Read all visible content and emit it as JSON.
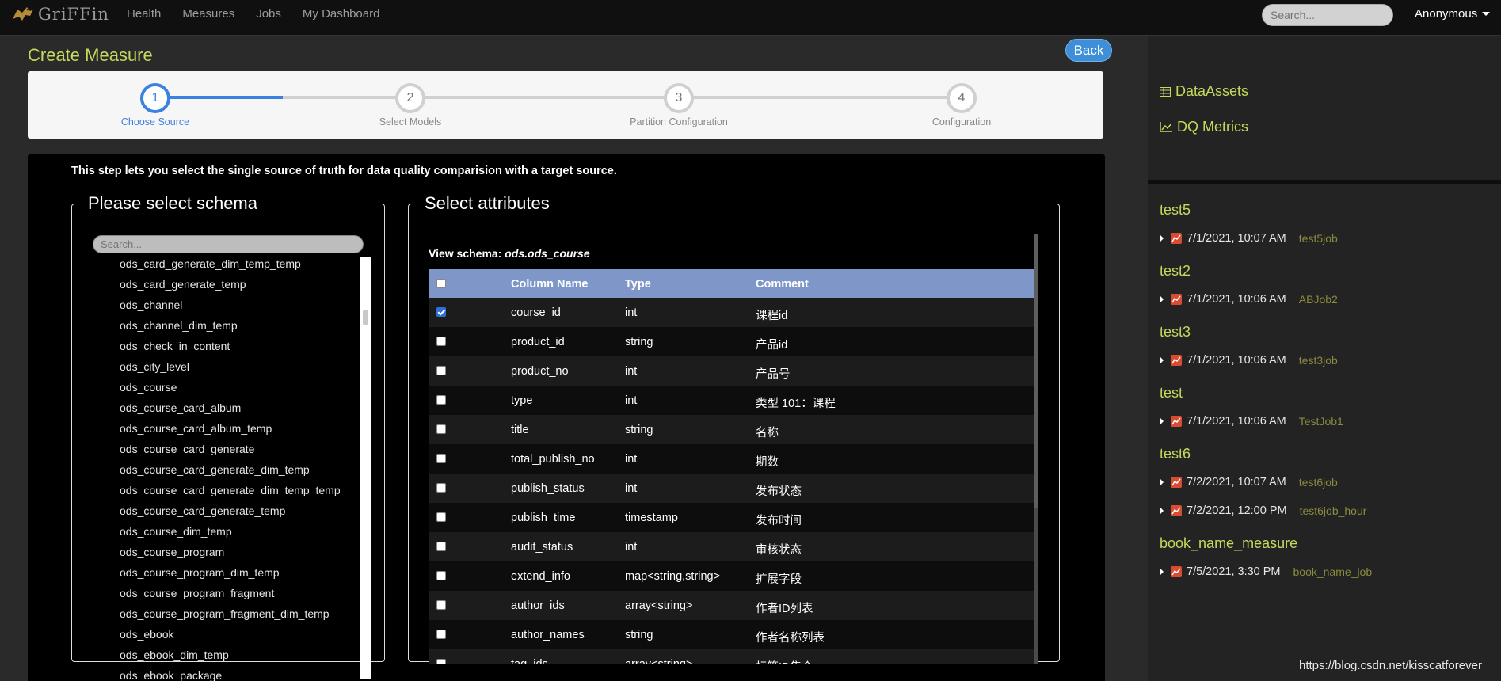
{
  "navbar": {
    "brand": "GriFFin",
    "links": [
      "Health",
      "Measures",
      "Jobs",
      "My Dashboard"
    ],
    "search_placeholder": "Search...",
    "user": "Anonymous"
  },
  "page": {
    "title": "Create Measure",
    "back_label": "Back",
    "steps": [
      {
        "number": "1",
        "label": "Choose Source",
        "active": true
      },
      {
        "number": "2",
        "label": "Select Models",
        "active": false
      },
      {
        "number": "3",
        "label": "Partition Configuration",
        "active": false
      },
      {
        "number": "4",
        "label": "Configuration",
        "active": false
      }
    ],
    "intro": "This step lets you select the single source of truth for data quality comparision with a target source."
  },
  "schema_panel": {
    "legend": "Please select schema",
    "search_placeholder": "Search...",
    "items": [
      "ods_card_generate_dim_temp_temp",
      "ods_card_generate_temp",
      "ods_channel",
      "ods_channel_dim_temp",
      "ods_check_in_content",
      "ods_city_level",
      "ods_course",
      "ods_course_card_album",
      "ods_course_card_album_temp",
      "ods_course_card_generate",
      "ods_course_card_generate_dim_temp",
      "ods_course_card_generate_dim_temp_temp",
      "ods_course_card_generate_temp",
      "ods_course_dim_temp",
      "ods_course_program",
      "ods_course_program_dim_temp",
      "ods_course_program_fragment",
      "ods_course_program_fragment_dim_temp",
      "ods_ebook",
      "ods_ebook_dim_temp",
      "ods_ebook_package"
    ]
  },
  "attr_panel": {
    "legend": "Select attributes",
    "view_schema_label": "View schema:",
    "view_schema_value": "ods.ods_course",
    "columns": [
      "Column Name",
      "Type",
      "Comment"
    ],
    "rows": [
      {
        "name": "course_id",
        "type": "int",
        "comment": "课程id",
        "checked": true
      },
      {
        "name": "product_id",
        "type": "string",
        "comment": "产品id",
        "checked": false
      },
      {
        "name": "product_no",
        "type": "int",
        "comment": "产品号",
        "checked": false
      },
      {
        "name": "type",
        "type": "int",
        "comment": "类型 101：课程",
        "checked": false
      },
      {
        "name": "title",
        "type": "string",
        "comment": "名称",
        "checked": false
      },
      {
        "name": "total_publish_no",
        "type": "int",
        "comment": "期数",
        "checked": false
      },
      {
        "name": "publish_status",
        "type": "int",
        "comment": "发布状态",
        "checked": false
      },
      {
        "name": "publish_time",
        "type": "timestamp",
        "comment": "发布时间",
        "checked": false
      },
      {
        "name": "audit_status",
        "type": "int",
        "comment": "审核状态",
        "checked": false
      },
      {
        "name": "extend_info",
        "type": "map<string,string>",
        "comment": "扩展字段",
        "checked": false
      },
      {
        "name": "author_ids",
        "type": "array<string>",
        "comment": "作者ID列表",
        "checked": false
      },
      {
        "name": "author_names",
        "type": "string",
        "comment": "作者名称列表",
        "checked": false
      },
      {
        "name": "tag_ids",
        "type": "array<string>",
        "comment": "标签ID集合",
        "checked": false
      }
    ]
  },
  "sidebar": {
    "nav": [
      {
        "label": "DataAssets",
        "icon": "table-icon"
      },
      {
        "label": "DQ Metrics",
        "icon": "line-chart-icon"
      }
    ],
    "jobs": [
      {
        "name": "test5",
        "runs": [
          {
            "time": "7/1/2021, 10:07 AM",
            "job": "test5job"
          }
        ]
      },
      {
        "name": "test2",
        "runs": [
          {
            "time": "7/1/2021, 10:06 AM",
            "job": "ABJob2"
          }
        ]
      },
      {
        "name": "test3",
        "runs": [
          {
            "time": "7/1/2021, 10:06 AM",
            "job": "test3job"
          }
        ]
      },
      {
        "name": "test",
        "runs": [
          {
            "time": "7/1/2021, 10:06 AM",
            "job": "TestJob1"
          }
        ]
      },
      {
        "name": "test6",
        "runs": [
          {
            "time": "7/2/2021, 10:07 AM",
            "job": "test6job"
          },
          {
            "time": "7/2/2021, 12:00 PM",
            "job": "test6job_hour"
          }
        ]
      },
      {
        "name": "book_name_measure",
        "runs": [
          {
            "time": "7/5/2021, 3:30 PM",
            "job": "book_name_job"
          }
        ]
      }
    ]
  },
  "watermark": "https://blog.csdn.net/kisscatforever",
  "colors": {
    "accent": "#c6d85d",
    "primary": "#3b82e0",
    "table_header": "#7f97c8"
  }
}
